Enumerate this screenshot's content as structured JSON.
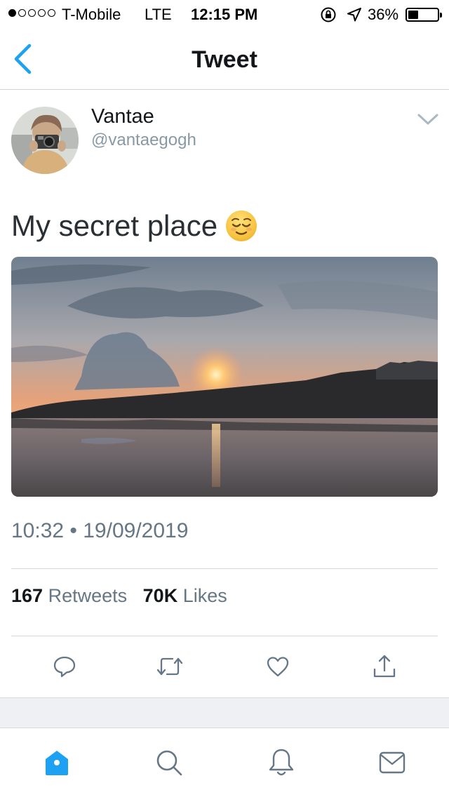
{
  "status_bar": {
    "carrier": "T-Mobile",
    "network": "LTE",
    "time": "12:15 PM",
    "battery": "36%",
    "signal_bars_filled": 1,
    "signal_bars_total": 5,
    "battery_level": 0.36
  },
  "nav": {
    "title": "Tweet",
    "back_icon": "chevron-left-icon"
  },
  "tweet": {
    "display_name": "Vantae",
    "handle": "@vantaegogh",
    "text": "My secret place",
    "emoji": "relieved-face",
    "timestamp": "10:32 • 19/09/2019",
    "retweets_count": "167",
    "retweets_label": "Retweets",
    "likes_count": "70K",
    "likes_label": "Likes"
  },
  "actions": [
    "reply-icon",
    "retweet-icon",
    "like-icon",
    "share-icon"
  ],
  "tabbar": [
    "home-icon",
    "search-icon",
    "notifications-icon",
    "messages-icon"
  ],
  "colors": {
    "accent": "#1da1f2",
    "icon_gray": "#657786",
    "secondary_text": "#8899a6"
  }
}
